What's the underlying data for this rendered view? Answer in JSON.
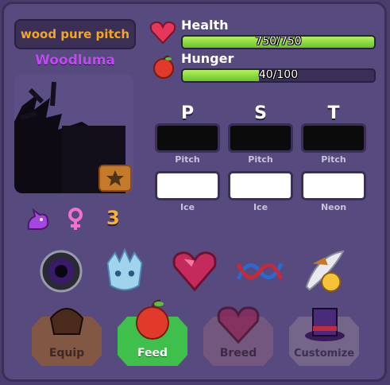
{
  "pet": {
    "name": "wood pure pitch",
    "species": "Woodluma",
    "age_count": "3"
  },
  "stats": {
    "health": {
      "label": "Health",
      "value_text": "750/750",
      "fraction": 1.0
    },
    "hunger": {
      "label": "Hunger",
      "value_text": "40/100",
      "fraction": 0.4
    }
  },
  "genes": [
    {
      "letter": "P",
      "top": "Pitch",
      "bottom": "Ice"
    },
    {
      "letter": "S",
      "top": "Pitch",
      "bottom": "Ice"
    },
    {
      "letter": "T",
      "top": "Pitch",
      "bottom": "Neon"
    }
  ],
  "items": [
    "void-orb-icon",
    "ice-dragon-head-icon",
    "heart-gem-icon",
    "dna-strand-icon",
    "feather-hat-icon"
  ],
  "actions": {
    "equip": "Equip",
    "feed": "Feed",
    "breed": "Breed",
    "customize": "Customize"
  },
  "colors": {
    "accent_name": "#f5a623",
    "species_color": "#c049f2",
    "bar_fill": "#8fdc3a",
    "feed_button": "#3fbf4c",
    "disabled_button": "#7a5a7e"
  }
}
